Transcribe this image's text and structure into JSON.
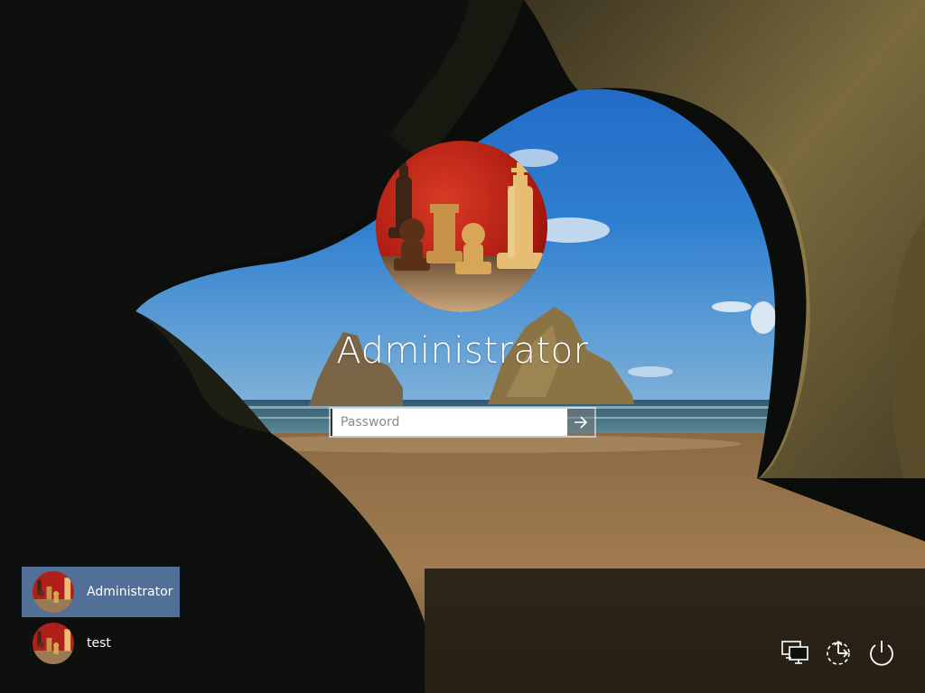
{
  "lock_screen": {
    "selected_user": "Administrator",
    "password_placeholder": "Password",
    "password_value": ""
  },
  "user_list": [
    {
      "name": "Administrator",
      "selected": true,
      "avatar": "chess-pieces-avatar"
    },
    {
      "name": "test",
      "selected": false,
      "avatar": "chess-pieces-avatar"
    }
  ],
  "system_icons": [
    "network-icon",
    "ease-of-access-icon",
    "power-icon"
  ],
  "colors": {
    "selected_tile": "#6e96cd",
    "avatar_bg": "#c0231a",
    "text": "#ffffff"
  }
}
